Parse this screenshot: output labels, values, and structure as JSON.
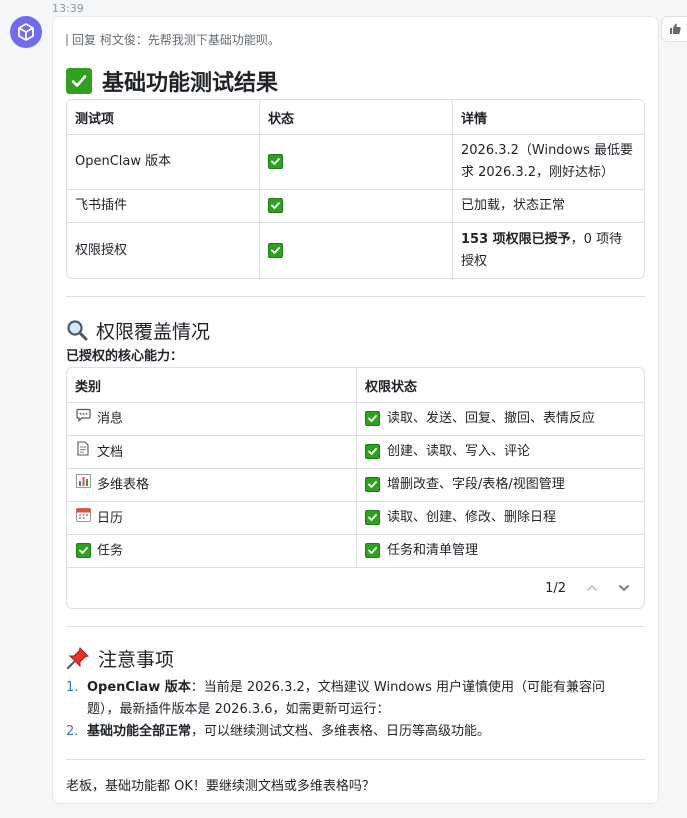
{
  "time": "13:39",
  "reply_text": "回复 柯文俊：先帮我测下基础功能呗。",
  "section1": {
    "title": "基础功能测试结果",
    "headers": [
      "测试项",
      "状态",
      "详情"
    ],
    "rows": [
      {
        "item": "OpenClaw 版本",
        "detail_l1": "2026.3.2（Windows 最低要",
        "detail_l2": "求 2026.3.2，刚好达标）"
      },
      {
        "item": "飞书插件",
        "detail_l1": "已加载，状态正常"
      },
      {
        "item": "权限授权",
        "detail_bold": "153 项权限已授予",
        "detail_rest": "，0 项待",
        "detail_l2": "授权"
      }
    ]
  },
  "section2": {
    "title": "权限覆盖情况",
    "subtitle": "已授权的核心能力：",
    "headers": [
      "类别",
      "权限状态"
    ],
    "rows": [
      {
        "icon": "speech-bubble-icon",
        "category": "消息",
        "status": "读取、发送、回复、撤回、表情反应"
      },
      {
        "icon": "document-icon",
        "category": "文档",
        "status": "创建、读取、写入、评论"
      },
      {
        "icon": "bar-chart-icon",
        "category": "多维表格",
        "status": "增删改查、字段/表格/视图管理"
      },
      {
        "icon": "calendar-icon",
        "category": "日历",
        "status": "读取、创建、修改、删除日程"
      },
      {
        "icon": "check-box-icon",
        "category": "任务",
        "status": "任务和清单管理"
      }
    ],
    "pager": "1/2"
  },
  "section3": {
    "title": "注意事项",
    "items": [
      {
        "num": "1.",
        "bold": "OpenClaw 版本",
        "text_l1": "：当前是 2026.3.2，文档建议 Windows 用户谨慎使用（可能有兼容问",
        "text_l2": "题），最新插件版本是 2026.3.6，如需更新可运行："
      },
      {
        "num": "2.",
        "bold": "基础功能全部正常",
        "text_l1": "，可以继续测试文档、多维表格、日历等高级功能。"
      }
    ]
  },
  "final_text": "老板，基础功能都 OK！要继续测文档或多维表格吗？",
  "colors": {
    "accent": "#3370ff",
    "check": "#2ea121",
    "avatar": "#6f6cf0"
  }
}
